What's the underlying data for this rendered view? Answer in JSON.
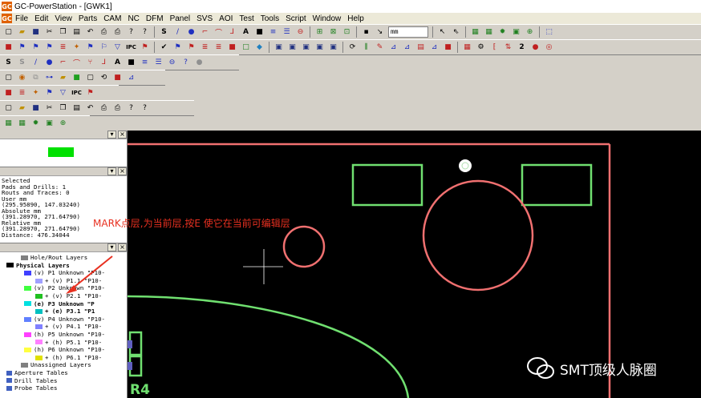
{
  "window": {
    "title": "GC-PowerStation - [GWK1]",
    "icon_text": "GC"
  },
  "menu": [
    "File",
    "Edit",
    "View",
    "Parts",
    "CAM",
    "NC",
    "DFM",
    "Panel",
    "SVS",
    "AOI",
    "Test",
    "Tools",
    "Script",
    "Window",
    "Help"
  ],
  "toolbar": {
    "units_combo": "mm"
  },
  "status_panel": {
    "lines": [
      "Selected",
      "Pads and Drills: 1",
      "Routs and Traces: 0",
      "User mm",
      "(295.95890, 147.03240)",
      "Absolute mm",
      "(391.28970, 271.64790)",
      "Relative mm",
      "(391.28970, 271.64790)",
      "Distance: 476.34044"
    ]
  },
  "layers": [
    {
      "label": "Hole/Rout Layers",
      "color": "#808080",
      "indent": 1
    },
    {
      "label": "Physical Layers",
      "color": "#000000",
      "indent": 0,
      "bold": true
    },
    {
      "label": "(v) P1 Unknown \"P10-",
      "color": "#4040ff",
      "indent": 2
    },
    {
      "label": "+ (v) P1.1 \"P10-",
      "color": "#a0a0ff",
      "indent": 3
    },
    {
      "label": "(v) P2 Unknown \"P10-",
      "color": "#40ff40",
      "indent": 2
    },
    {
      "label": "+ (v) P2.1 \"P10-",
      "color": "#20c020",
      "indent": 3
    },
    {
      "label": "(e) P3 Unknown \"P",
      "color": "#00e0e0",
      "indent": 2,
      "bold": true
    },
    {
      "label": "+ (e) P3.1 \"P1",
      "color": "#00c0c0",
      "indent": 3,
      "bold": true
    },
    {
      "label": "(v) P4 Unknown \"P10-",
      "color": "#6080ff",
      "indent": 2
    },
    {
      "label": "+ (v) P4.1 \"P10-",
      "color": "#8080ff",
      "indent": 3
    },
    {
      "label": "(h) P5 Unknown \"P10-",
      "color": "#ff40ff",
      "indent": 2
    },
    {
      "label": "+ (h) P5.1 \"P10-",
      "color": "#ff80ff",
      "indent": 3
    },
    {
      "label": "(h) P6 Unknown \"P10-",
      "color": "#ffff40",
      "indent": 2
    },
    {
      "label": "+ (h) P6.1 \"P10-",
      "color": "#e0e000",
      "indent": 3
    },
    {
      "label": "Unassigned Layers",
      "color": "#808080",
      "indent": 1
    },
    {
      "label": "Aperture Tables",
      "color": "#4060c0",
      "indent": 0
    },
    {
      "label": "Drill Tables",
      "color": "#4060c0",
      "indent": 0
    },
    {
      "label": "Probe Tables",
      "color": "#4060c0",
      "indent": 0
    }
  ],
  "annotation": {
    "text": "MARK点层,为当前层,按E 使它在当前可编辑层"
  },
  "canvas": {
    "label_r4": "R4"
  },
  "watermark": {
    "text": "SMT顶级人脉圈"
  },
  "colors": {
    "outline": "#f07070",
    "pad": "#70e070",
    "background": "#000000",
    "annotation": "#e83020"
  }
}
